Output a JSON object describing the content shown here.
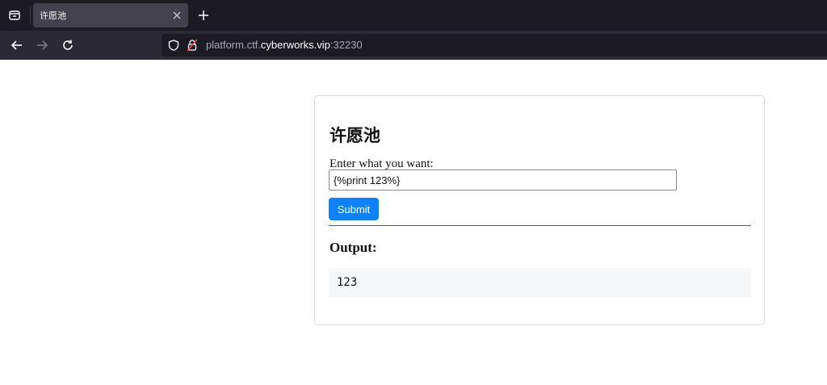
{
  "browser": {
    "tab": {
      "title": "许愿池",
      "close_icon": "close-icon"
    },
    "new_tab_icon": "plus-icon",
    "tab_list_icon": "tab-list-icon",
    "address": {
      "prefix": "platform.ctf.",
      "host": "cyberworks.vip",
      "suffix": ":32230"
    },
    "nav_icons": [
      "back-arrow-icon",
      "forward-arrow-icon",
      "reload-icon",
      "shield-icon",
      "lock-icon"
    ],
    "colors": {
      "chrome_dark": "#1c1b22",
      "toolbar": "#2b2a33",
      "tab_active": "#42414d"
    }
  },
  "page": {
    "title": "许愿池",
    "input_label": "Enter what you want:",
    "input_value": "{%print 123%}",
    "submit_label": "Submit",
    "output_heading": "Output:",
    "output_value": "123",
    "colors": {
      "submit_bg": "#0d82fa",
      "output_bg": "#f6f7f9"
    }
  }
}
